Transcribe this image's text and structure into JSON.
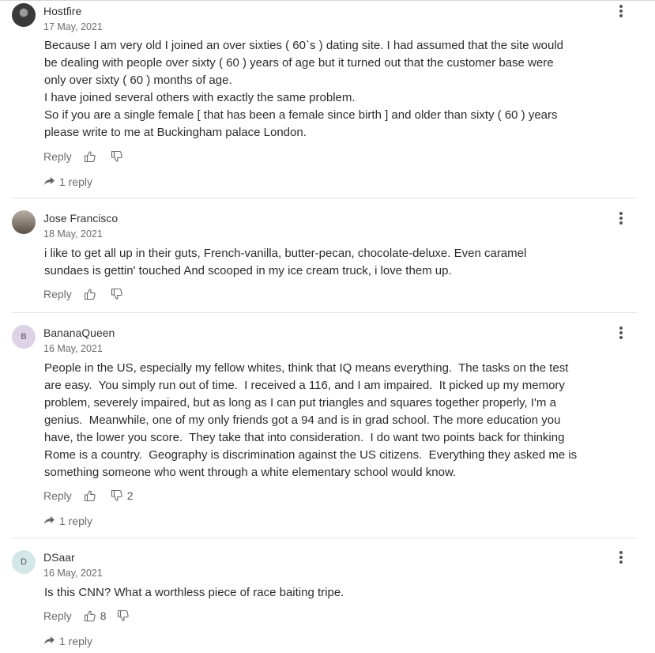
{
  "comments": [
    {
      "username": "Hostfire",
      "date": "17 May, 2021",
      "avatar_type": "photo",
      "body": [
        "Because I am very old I joined an over sixties ( 60`s ) dating site. I had assumed that the site would",
        "be dealing with people over sixty ( 60 ) years of age but it turned out that the customer base were",
        "only over sixty ( 60 ) months of age.",
        "I have joined several others with exactly the same problem.",
        "So if you are a single female [ that has been a female since birth ] and older than sixty ( 60 ) years",
        "please write to me at Buckingham palace London."
      ],
      "reply_label": "Reply",
      "likes": "",
      "dislikes": "",
      "replies_label": "1 reply"
    },
    {
      "username": "Jose Francisco",
      "date": "18 May, 2021",
      "avatar_type": "photo",
      "body": [
        "i like to get all up in their guts, French-vanilla, butter-pecan, chocolate-deluxe. Even caramel",
        "sundaes is gettin' touched And scooped in my ice cream truck, i love them up."
      ],
      "reply_label": "Reply",
      "likes": "",
      "dislikes": "",
      "replies_label": ""
    },
    {
      "username": "BananaQueen",
      "date": "16 May, 2021",
      "avatar_type": "letter",
      "avatar_letter": "B",
      "avatar_color": "#dcd3e6",
      "body": [
        "People in the US, especially my fellow whites, think that IQ means everything.  The tasks on the test",
        "are easy.  You simply run out of time.  I received a 116, and I am impaired.  It picked up my memory",
        "problem, severely impaired, but as long as I can put triangles and squares together properly, I'm a",
        "genius.  Meanwhile, one of my only friends got a 94 and is in grad school. The more education you",
        "have, the lower you score.  They take that into consideration.  I do want two points back for thinking",
        "Rome is a country.  Geography is discrimination against the US citizens.  Everything they asked me is",
        "something someone who went through a white elementary school would know."
      ],
      "reply_label": "Reply",
      "likes": "",
      "dislikes": "2",
      "replies_label": "1 reply"
    },
    {
      "username": "DSaar",
      "date": "16 May, 2021",
      "avatar_type": "letter",
      "avatar_letter": "D",
      "avatar_color": "#d3e6e8",
      "body": [
        "Is this CNN? What a worthless piece of race baiting tripe."
      ],
      "reply_label": "Reply",
      "likes": "8",
      "dislikes": "",
      "replies_label": "1 reply"
    }
  ],
  "icons": {
    "more": "vertical-ellipsis",
    "like": "thumbs-up-outline",
    "dislike": "thumbs-down-outline",
    "replies": "reply-arrow"
  },
  "colors": {
    "text": "#2b2b2b",
    "muted": "#6b6b6b",
    "divider": "#e3e3e3"
  }
}
